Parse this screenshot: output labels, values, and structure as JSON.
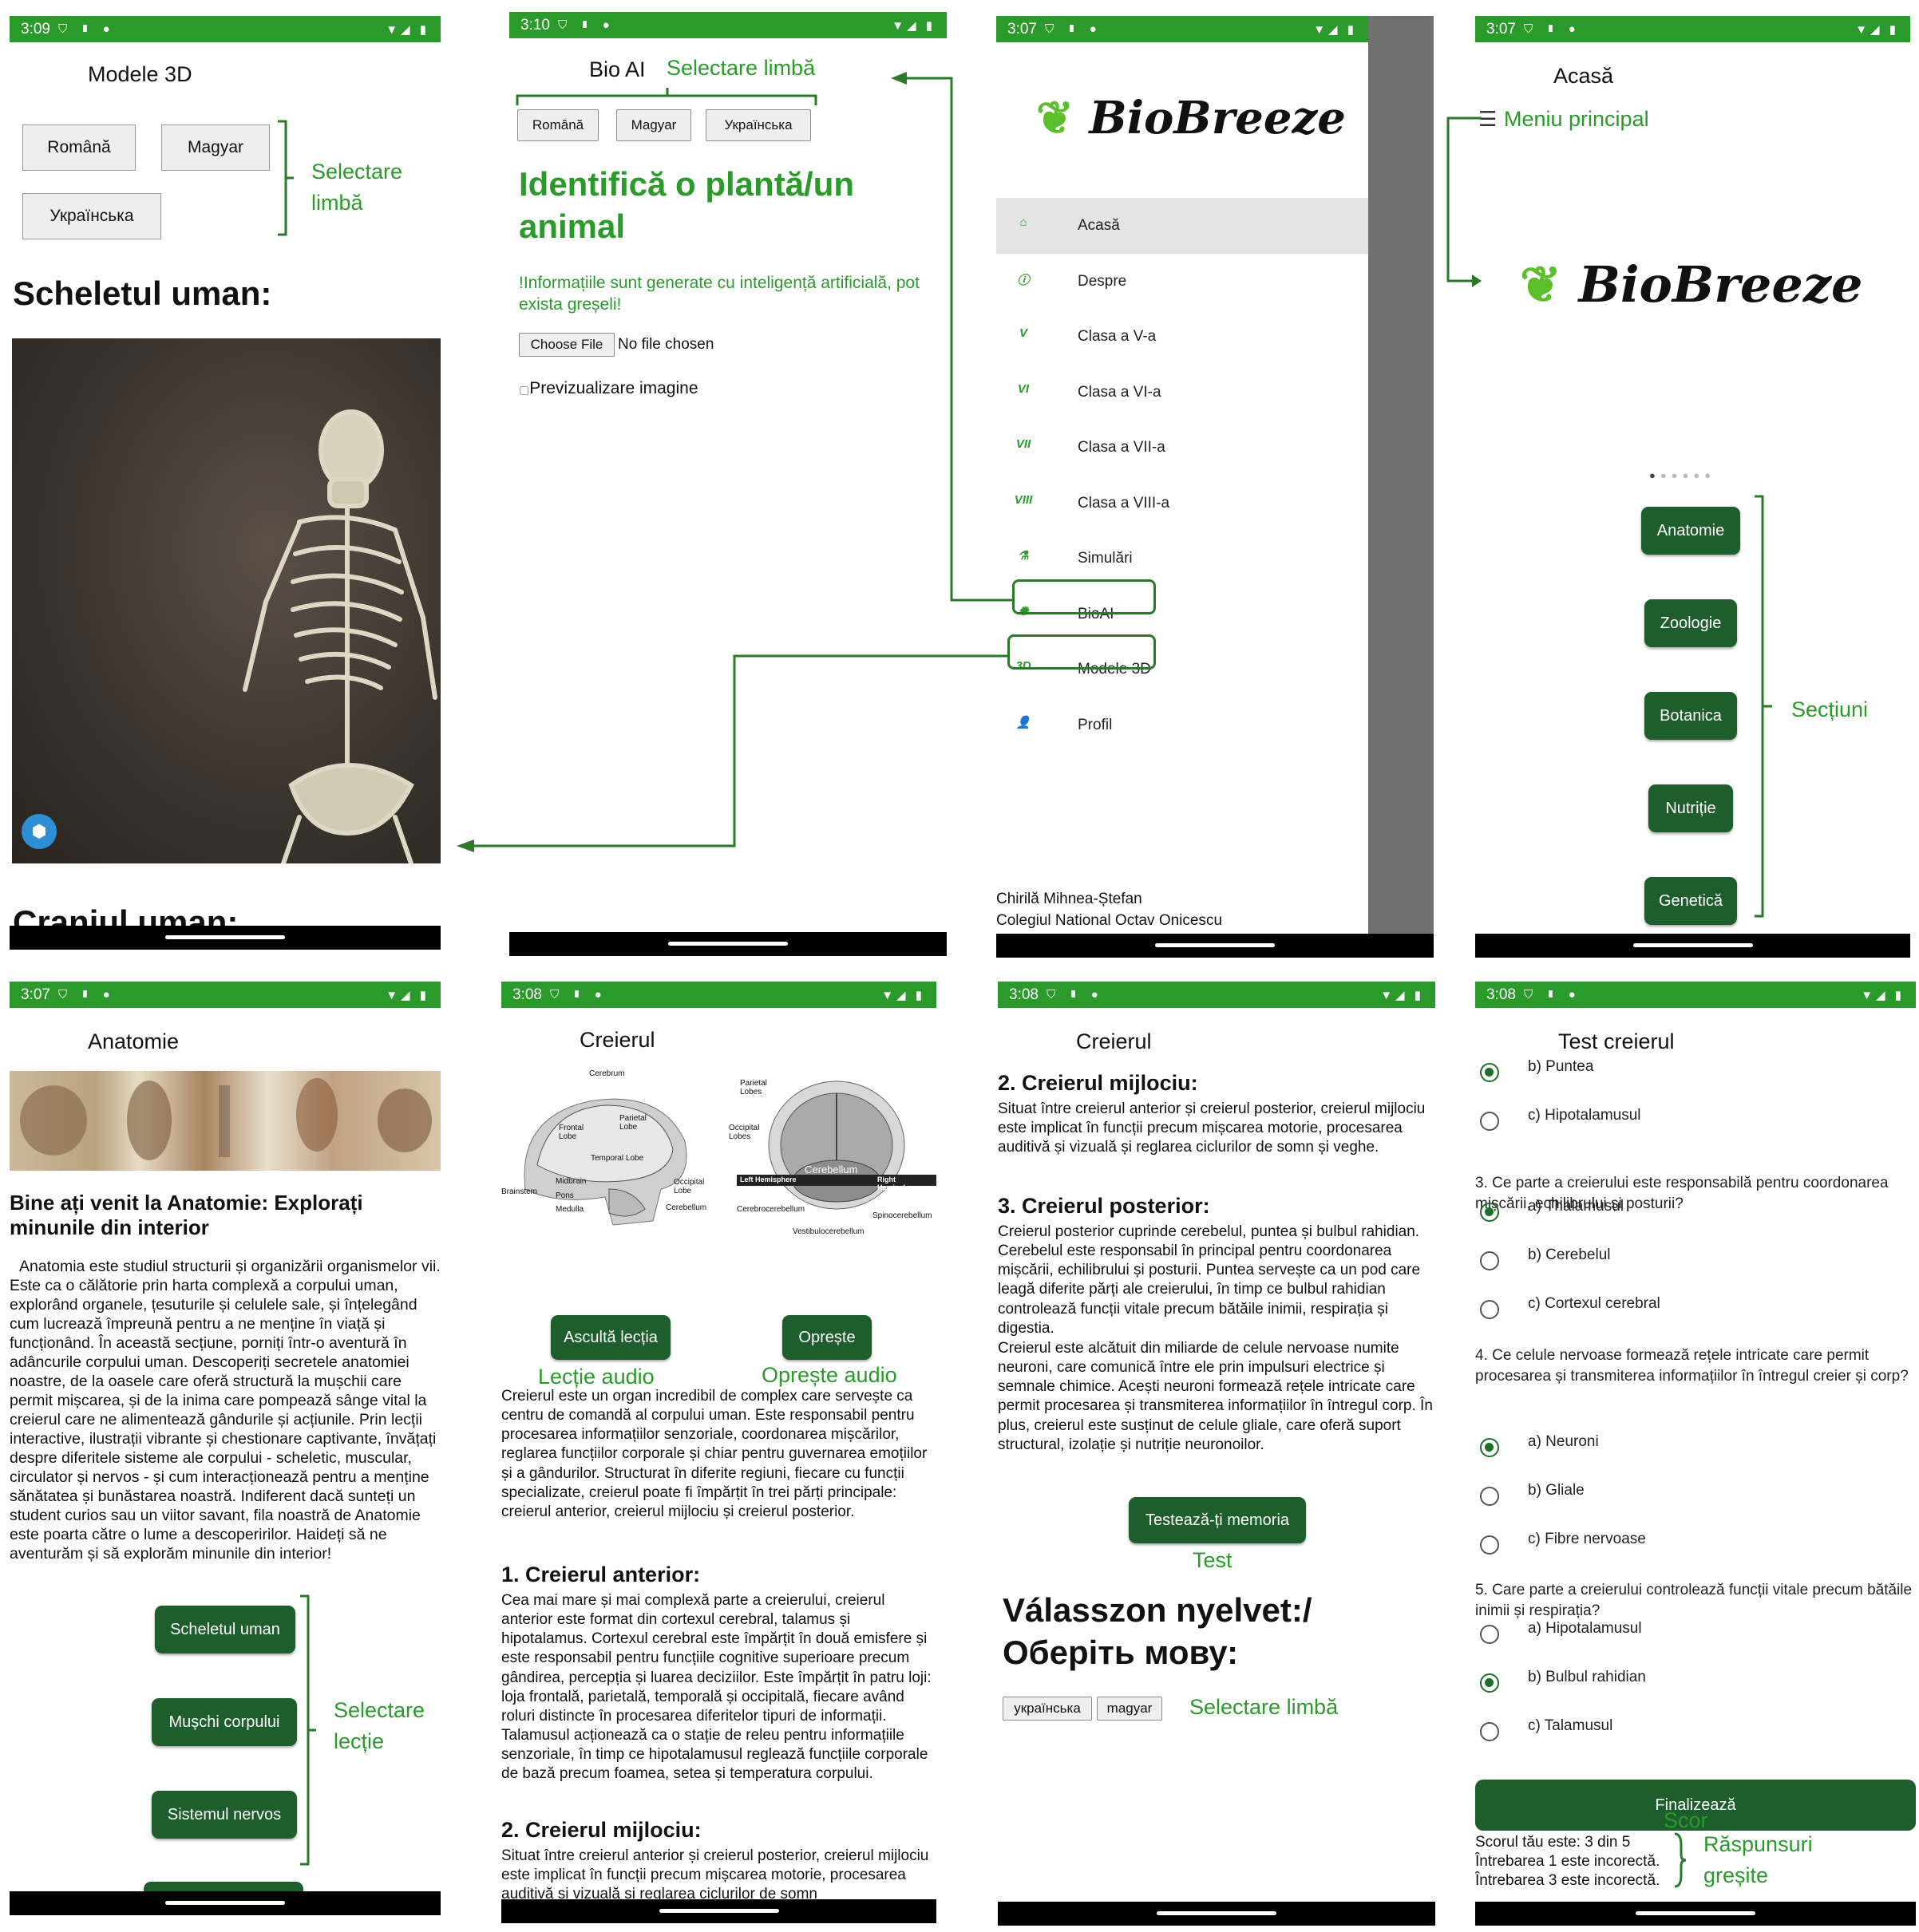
{
  "status_times": [
    "3:09",
    "3:10",
    "3:07",
    "3:07",
    "3:07",
    "3:08",
    "3:08",
    "3:08"
  ],
  "colors": {
    "green": "#2a9a2a",
    "dark_green": "#1e5e2c",
    "annotation": "#2a9a2a"
  },
  "p1": {
    "title": "Modele 3D",
    "lang_buttons": [
      "Română",
      "Magyar",
      "Українська"
    ],
    "annot_lang": [
      "Selectare",
      "limbă"
    ],
    "section_title": "Scheletul uman:",
    "next_title": "Craniul uman:",
    "viewer_icon": "3d-cube-icon"
  },
  "p2": {
    "title": "Bio AI",
    "annot": "Selectare limbă",
    "lang_buttons": [
      "Română",
      "Magyar",
      "Українська"
    ],
    "heading": "Identifică o plantă/un animal",
    "warning": "!Informațiile sunt generate cu inteligență artificială, pot exista greșeli!",
    "file_button": "Choose File",
    "file_status": "No file chosen",
    "preview_alt": "Previzualizare imagine"
  },
  "p3": {
    "logo": "BioBreeze",
    "menu": [
      {
        "icon": "home-icon",
        "glyph": "⌂",
        "label": "Acasă"
      },
      {
        "icon": "info-icon",
        "glyph": "ⓘ",
        "label": "Despre"
      },
      {
        "icon": "grade-5-icon",
        "glyph": "V",
        "label": "Clasa a V-a"
      },
      {
        "icon": "grade-6-icon",
        "glyph": "VI",
        "label": "Clasa a VI-a"
      },
      {
        "icon": "grade-7-icon",
        "glyph": "VII",
        "label": "Clasa a VII-a"
      },
      {
        "icon": "grade-8-icon",
        "glyph": "VIII",
        "label": "Clasa a VIII-a"
      },
      {
        "icon": "simulation-icon",
        "glyph": "⚗",
        "label": "Simulări"
      },
      {
        "icon": "ai-icon",
        "glyph": "✺",
        "label": "BioAI"
      },
      {
        "icon": "3d-model-icon",
        "glyph": "3D",
        "label": "Modele 3D"
      },
      {
        "icon": "profile-icon",
        "glyph": "👤",
        "label": "Profil"
      }
    ],
    "footer_name": "Chirilă Mihnea-Ștefan",
    "footer_school": "Colegiul National Octav Onicescu"
  },
  "p4": {
    "title": "Acasă",
    "annot_menu": "Meniu principal",
    "logo": "BioBreeze",
    "sections": [
      "Anatomie",
      "Zoologie",
      "Botanica",
      "Nutriție",
      "Genetică"
    ],
    "annot_sections": "Secțiuni"
  },
  "p5": {
    "title": "Anatomie",
    "heading": "Bine ați venit la Anatomie: Explorați minunile din interior",
    "body": "Anatomia este studiul structurii și organizării organismelor vii. Este ca o călătorie prin harta complexă a corpului uman, explorând organele, țesuturile și celulele sale, și înțelegând cum lucrează împreună pentru a ne menține în viață și funcționând. În această secțiune, porniți într-o aventură în adâncurile corpului uman. Descoperiți secretele anatomiei noastre, de la oasele care oferă structură la mușchii care permit mișcarea, și de la inima care pompează sânge vital la creierul care ne alimentează gândurile și acțiunile. Prin lecții interactive, ilustrații vibrante și chestionare captivante, învățați despre diferitele sisteme ale corpului - scheletic, muscular, circulator și nervos - și cum interacționează pentru a menține sănătatea și bunăstarea noastră. Indiferent dacă sunteți un student curios sau un viitor savant, fila noastră de Anatomie este poarta către o lume a descoperirilor. Haideți să ne aventurăm și să explorăm minunile din interior!",
    "lessons": [
      "Scheletul uman",
      "Mușchi corpului",
      "Sistemul nervos"
    ],
    "annot_lesson": [
      "Selectare",
      "lecție"
    ]
  },
  "p6": {
    "title": "Creierul",
    "diagram1_labels": [
      "Cerebrum",
      "Frontal Lobe",
      "Parietal Lobe",
      "Temporal Lobe",
      "Occipital Lobe",
      "Midbrain",
      "Pons",
      "Medulla",
      "Brainstem",
      "Cerebellum"
    ],
    "diagram2_labels": [
      "Parietal Lobes",
      "Occipital Lobes",
      "Cerebellum",
      "Left Hemisphere",
      "Right Hemisphere",
      "Cerebrocerebellum",
      "Spinocerebellum",
      "Vestibulocerebellum"
    ],
    "listen_btn": "Ascultă lecția",
    "stop_btn": "Oprește",
    "annot_audio": "Lecție audio",
    "annot_stop": "Oprește audio",
    "intro": "Creierul este un organ incredibil de complex care servește ca centru de comandă al corpului uman. Este responsabil pentru procesarea informațiilor senzoriale, coordonarea mișcărilor, reglarea funcțiilor corporale și chiar pentru guvernarea emoțiilor și a gândurilor. Structurat în diferite regiuni, fiecare cu funcții specializate, creierul poate fi împărțit în trei părți principale: creierul anterior, creierul mijlociu și creierul posterior.",
    "h_anterior": "1. Creierul anterior:",
    "anterior": "Cea mai mare și mai complexă parte a creierului, creierul anterior este format din cortexul cerebral, talamus și hipotalamus. Cortexul cerebral este împărțit în două emisfere și este responsabil pentru funcțiile cognitive superioare precum gândirea, percepția și luarea deciziilor. Este împărțit în patru loji: loja frontală, parietală, temporală și occipitală, fiecare având roluri distincte în procesarea diferitelor tipuri de informații. Talamusul acționează ca o stație de releu pentru informațiile senzoriale, în timp ce hipotalamusul reglează funcțiile corporale de bază precum foamea, setea și temperatura corpului.",
    "h_mijlociu": "2. Creierul mijlociu:",
    "mijlociu": "Situat între creierul anterior și creierul posterior, creierul mijlociu este implicat în funcții precum mișcarea motorie, procesarea auditivă și vizuală și reglarea ciclurilor de somn"
  },
  "p7": {
    "title": "Creierul",
    "h_mijlociu": "2. Creierul mijlociu:",
    "mijlociu": "Situat între creierul anterior și creierul posterior, creierul mijlociu este implicat în funcții precum mișcarea motorie, procesarea auditivă și vizuală și reglarea ciclurilor de somn și veghe.",
    "h_posterior": "3. Creierul posterior:",
    "posterior": "Creierul posterior cuprinde cerebelul, puntea și bulbul rahidian. Cerebelul este responsabil în principal pentru coordonarea mișcării, echilibrului și posturii. Puntea servește ca un pod care leagă diferite părți ale creierului, în timp ce bulbul rahidian controlează funcții vitale precum bătăile inimii, respirația și digestia.",
    "neurons": "Creierul este alcătuit din miliarde de celule nervoase numite neuroni, care comunică între ele prin impulsuri electrice și semnale chimice. Acești neuroni formează rețele intricate care permit procesarea și transmiterea informațiilor în întregul corp. În plus, creierul este susținut de celule gliale, care oferă suport structural, izolație și nutriție neuronoilor.",
    "test_btn": "Testează-ți memoria",
    "annot_test": "Test",
    "lang_prompt_1": "Válasszon nyelvet:/",
    "lang_prompt_2": "Оберіть мову:",
    "lang_buttons": [
      "українська",
      "magyar"
    ],
    "annot_lang": "Selectare limbă"
  },
  "p8": {
    "title": "Test creierul",
    "q2_options": [
      {
        "label": "b) Puntea",
        "selected": true
      },
      {
        "label": "c) Hipotalamusul",
        "selected": false
      }
    ],
    "q3": "3. Ce parte a creierului este responsabilă pentru coordonarea mișcării, echilibrului și posturii?",
    "q3_options": [
      {
        "label": "a) Thalamusul",
        "selected": true
      },
      {
        "label": "b) Cerebelul",
        "selected": false
      },
      {
        "label": "c) Cortexul cerebral",
        "selected": false
      }
    ],
    "q4": "4. Ce celule nervoase formează rețele intricate care permit procesarea și transmiterea informațiilor în întregul creier și corp?",
    "q4_options": [
      {
        "label": "a) Neuroni",
        "selected": true
      },
      {
        "label": "b) Gliale",
        "selected": false
      },
      {
        "label": "c) Fibre nervoase",
        "selected": false
      }
    ],
    "q5": "5. Care parte a creierului controlează funcții vitale precum bătăile inimii și respirația?",
    "q5_options": [
      {
        "label": "a) Hipotalamusul",
        "selected": false
      },
      {
        "label": "b) Bulbul rahidian",
        "selected": true
      },
      {
        "label": "c) Talamusul",
        "selected": false
      }
    ],
    "finish_btn": "Finalizează",
    "score": "Scorul tău este: 3 din 5",
    "annot_score": "Scor",
    "wrong_1": "Întrebarea 1 este incorectă.",
    "wrong_3": "Întrebarea 3 este incorectă.",
    "annot_wrong": [
      "Răspunsuri",
      "greșite"
    ]
  }
}
